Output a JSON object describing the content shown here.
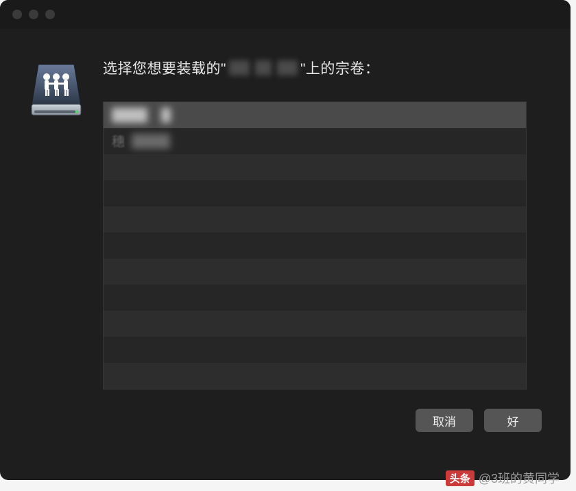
{
  "dialog": {
    "prompt_prefix": "选择您想要装载的\"",
    "prompt_suffix": "\"上的宗卷：",
    "server_name_redacted": true,
    "volumes": [
      {
        "label_redacted": true,
        "selected": true
      },
      {
        "label_partial": "穗",
        "label_redacted": true,
        "selected": false
      },
      {
        "label": "",
        "selected": false
      },
      {
        "label": "",
        "selected": false
      },
      {
        "label": "",
        "selected": false
      },
      {
        "label": "",
        "selected": false
      },
      {
        "label": "",
        "selected": false
      },
      {
        "label": "",
        "selected": false
      },
      {
        "label": "",
        "selected": false
      },
      {
        "label": "",
        "selected": false
      },
      {
        "label": "",
        "selected": false
      }
    ],
    "buttons": {
      "cancel": "取消",
      "ok": "好"
    }
  },
  "watermark": {
    "brand": "头条",
    "handle": "@3班的黄同学"
  }
}
